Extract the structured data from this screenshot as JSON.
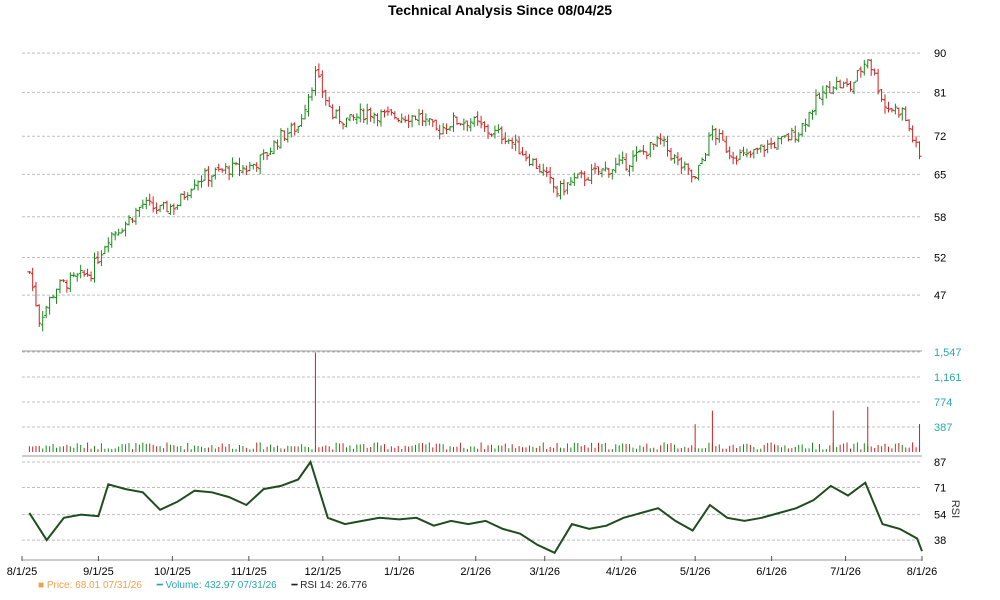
{
  "chart_data": {
    "type": "candlestick",
    "title": "Technical Analysis Since 08/04/25",
    "x_ticks": [
      "8/1/25",
      "9/1/25",
      "10/1/25",
      "11/1/25",
      "12/1/25",
      "1/1/26",
      "2/1/26",
      "3/1/26",
      "4/1/26",
      "5/1/26",
      "6/1/26",
      "7/1/26",
      "8/1/26"
    ],
    "price": {
      "yscale": "log",
      "ylim": [
        42,
        91
      ],
      "y_ticks": [
        "90",
        "81",
        "72",
        "65",
        "58",
        "52",
        "47"
      ],
      "series": [
        {
          "date": "2025-08-04",
          "close": 50
        },
        {
          "date": "2025-08-08",
          "close": 44
        },
        {
          "date": "2025-08-15",
          "close": 48
        },
        {
          "date": "2025-08-22",
          "close": 49
        },
        {
          "date": "2025-08-29",
          "close": 50
        },
        {
          "date": "2025-09-05",
          "close": 55
        },
        {
          "date": "2025-09-12",
          "close": 57
        },
        {
          "date": "2025-09-19",
          "close": 60
        },
        {
          "date": "2025-09-26",
          "close": 59
        },
        {
          "date": "2025-10-03",
          "close": 60
        },
        {
          "date": "2025-10-10",
          "close": 64
        },
        {
          "date": "2025-10-17",
          "close": 65
        },
        {
          "date": "2025-10-24",
          "close": 66
        },
        {
          "date": "2025-10-31",
          "close": 66
        },
        {
          "date": "2025-11-07",
          "close": 68
        },
        {
          "date": "2025-11-14",
          "close": 72
        },
        {
          "date": "2025-11-21",
          "close": 74
        },
        {
          "date": "2025-11-28",
          "close": 85
        },
        {
          "date": "2025-12-05",
          "close": 76
        },
        {
          "date": "2025-12-12",
          "close": 75
        },
        {
          "date": "2025-12-19",
          "close": 77
        },
        {
          "date": "2025-12-26",
          "close": 76
        },
        {
          "date": "2026-01-02",
          "close": 76
        },
        {
          "date": "2026-01-09",
          "close": 76
        },
        {
          "date": "2026-01-16",
          "close": 73
        },
        {
          "date": "2026-01-23",
          "close": 75
        },
        {
          "date": "2026-01-30",
          "close": 75
        },
        {
          "date": "2026-02-06",
          "close": 73
        },
        {
          "date": "2026-02-13",
          "close": 72
        },
        {
          "date": "2026-02-20",
          "close": 69
        },
        {
          "date": "2026-02-27",
          "close": 66
        },
        {
          "date": "2026-03-06",
          "close": 62
        },
        {
          "date": "2026-03-13",
          "close": 64
        },
        {
          "date": "2026-03-20",
          "close": 65
        },
        {
          "date": "2026-03-27",
          "close": 66
        },
        {
          "date": "2026-04-03",
          "close": 67
        },
        {
          "date": "2026-04-10",
          "close": 69
        },
        {
          "date": "2026-04-17",
          "close": 71
        },
        {
          "date": "2026-04-24",
          "close": 67
        },
        {
          "date": "2026-05-01",
          "close": 64
        },
        {
          "date": "2026-05-08",
          "close": 73
        },
        {
          "date": "2026-05-15",
          "close": 69
        },
        {
          "date": "2026-05-22",
          "close": 68
        },
        {
          "date": "2026-05-29",
          "close": 70
        },
        {
          "date": "2026-06-05",
          "close": 71
        },
        {
          "date": "2026-06-12",
          "close": 73
        },
        {
          "date": "2026-06-19",
          "close": 79
        },
        {
          "date": "2026-06-26",
          "close": 83
        },
        {
          "date": "2026-07-03",
          "close": 82
        },
        {
          "date": "2026-07-10",
          "close": 89
        },
        {
          "date": "2026-07-17",
          "close": 78
        },
        {
          "date": "2026-07-24",
          "close": 77
        },
        {
          "date": "2026-07-31",
          "close": 68
        }
      ]
    },
    "volume": {
      "ylim": [
        0,
        1547
      ],
      "y_ticks": [
        "1,547",
        "1,161",
        "774",
        "387"
      ],
      "spikes": [
        {
          "date": "2025-11-28",
          "value": 1540
        },
        {
          "date": "2026-05-01",
          "value": 430
        },
        {
          "date": "2026-05-08",
          "value": 640
        },
        {
          "date": "2026-06-26",
          "value": 640
        },
        {
          "date": "2026-07-10",
          "value": 700
        },
        {
          "date": "2026-07-31",
          "value": 433
        }
      ]
    },
    "rsi": {
      "ylim": [
        28,
        87
      ],
      "y_ticks": [
        "87",
        "71",
        "54",
        "38"
      ],
      "label": "RSI",
      "series": [
        {
          "date": "2025-08-04",
          "value": 55
        },
        {
          "date": "2025-08-11",
          "value": 38
        },
        {
          "date": "2025-08-18",
          "value": 52
        },
        {
          "date": "2025-08-25",
          "value": 54
        },
        {
          "date": "2025-09-01",
          "value": 53
        },
        {
          "date": "2025-09-05",
          "value": 73
        },
        {
          "date": "2025-09-12",
          "value": 70
        },
        {
          "date": "2025-09-19",
          "value": 68
        },
        {
          "date": "2025-09-26",
          "value": 57
        },
        {
          "date": "2025-10-03",
          "value": 62
        },
        {
          "date": "2025-10-10",
          "value": 69
        },
        {
          "date": "2025-10-17",
          "value": 68
        },
        {
          "date": "2025-10-24",
          "value": 65
        },
        {
          "date": "2025-10-31",
          "value": 60
        },
        {
          "date": "2025-11-07",
          "value": 70
        },
        {
          "date": "2025-11-14",
          "value": 72
        },
        {
          "date": "2025-11-21",
          "value": 76
        },
        {
          "date": "2025-11-26",
          "value": 87
        },
        {
          "date": "2025-12-03",
          "value": 52
        },
        {
          "date": "2025-12-10",
          "value": 48
        },
        {
          "date": "2025-12-17",
          "value": 50
        },
        {
          "date": "2025-12-24",
          "value": 52
        },
        {
          "date": "2026-01-01",
          "value": 51
        },
        {
          "date": "2026-01-08",
          "value": 52
        },
        {
          "date": "2026-01-15",
          "value": 47
        },
        {
          "date": "2026-01-22",
          "value": 50
        },
        {
          "date": "2026-01-29",
          "value": 48
        },
        {
          "date": "2026-02-05",
          "value": 50
        },
        {
          "date": "2026-02-12",
          "value": 45
        },
        {
          "date": "2026-02-19",
          "value": 42
        },
        {
          "date": "2026-02-26",
          "value": 35
        },
        {
          "date": "2026-03-05",
          "value": 30
        },
        {
          "date": "2026-03-12",
          "value": 48
        },
        {
          "date": "2026-03-19",
          "value": 45
        },
        {
          "date": "2026-03-26",
          "value": 47
        },
        {
          "date": "2026-04-02",
          "value": 52
        },
        {
          "date": "2026-04-09",
          "value": 55
        },
        {
          "date": "2026-04-16",
          "value": 58
        },
        {
          "date": "2026-04-23",
          "value": 50
        },
        {
          "date": "2026-04-30",
          "value": 44
        },
        {
          "date": "2026-05-07",
          "value": 60
        },
        {
          "date": "2026-05-14",
          "value": 52
        },
        {
          "date": "2026-05-21",
          "value": 50
        },
        {
          "date": "2026-05-28",
          "value": 52
        },
        {
          "date": "2026-06-04",
          "value": 55
        },
        {
          "date": "2026-06-11",
          "value": 58
        },
        {
          "date": "2026-06-18",
          "value": 63
        },
        {
          "date": "2026-06-25",
          "value": 72
        },
        {
          "date": "2026-07-02",
          "value": 66
        },
        {
          "date": "2026-07-09",
          "value": 74
        },
        {
          "date": "2026-07-16",
          "value": 48
        },
        {
          "date": "2026-07-23",
          "value": 45
        },
        {
          "date": "2026-07-30",
          "value": 39
        },
        {
          "date": "2026-08-01",
          "value": 31
        }
      ]
    },
    "legend": [
      {
        "label": "Price: 68.01  07/31/26",
        "color": "#f0a04b"
      },
      {
        "label": "Volume: 432.97  07/31/26",
        "color": "#2aa8a8"
      },
      {
        "label": "RSI 14: 26.776",
        "color": "#222222"
      }
    ],
    "colors": {
      "up": "#1a8a1a",
      "down": "#cc2222",
      "rsi_line": "#1f4d1f",
      "grid": "#bfbfbf",
      "tick_price": "#000000",
      "tick_volume": "#2aa8a8"
    }
  }
}
